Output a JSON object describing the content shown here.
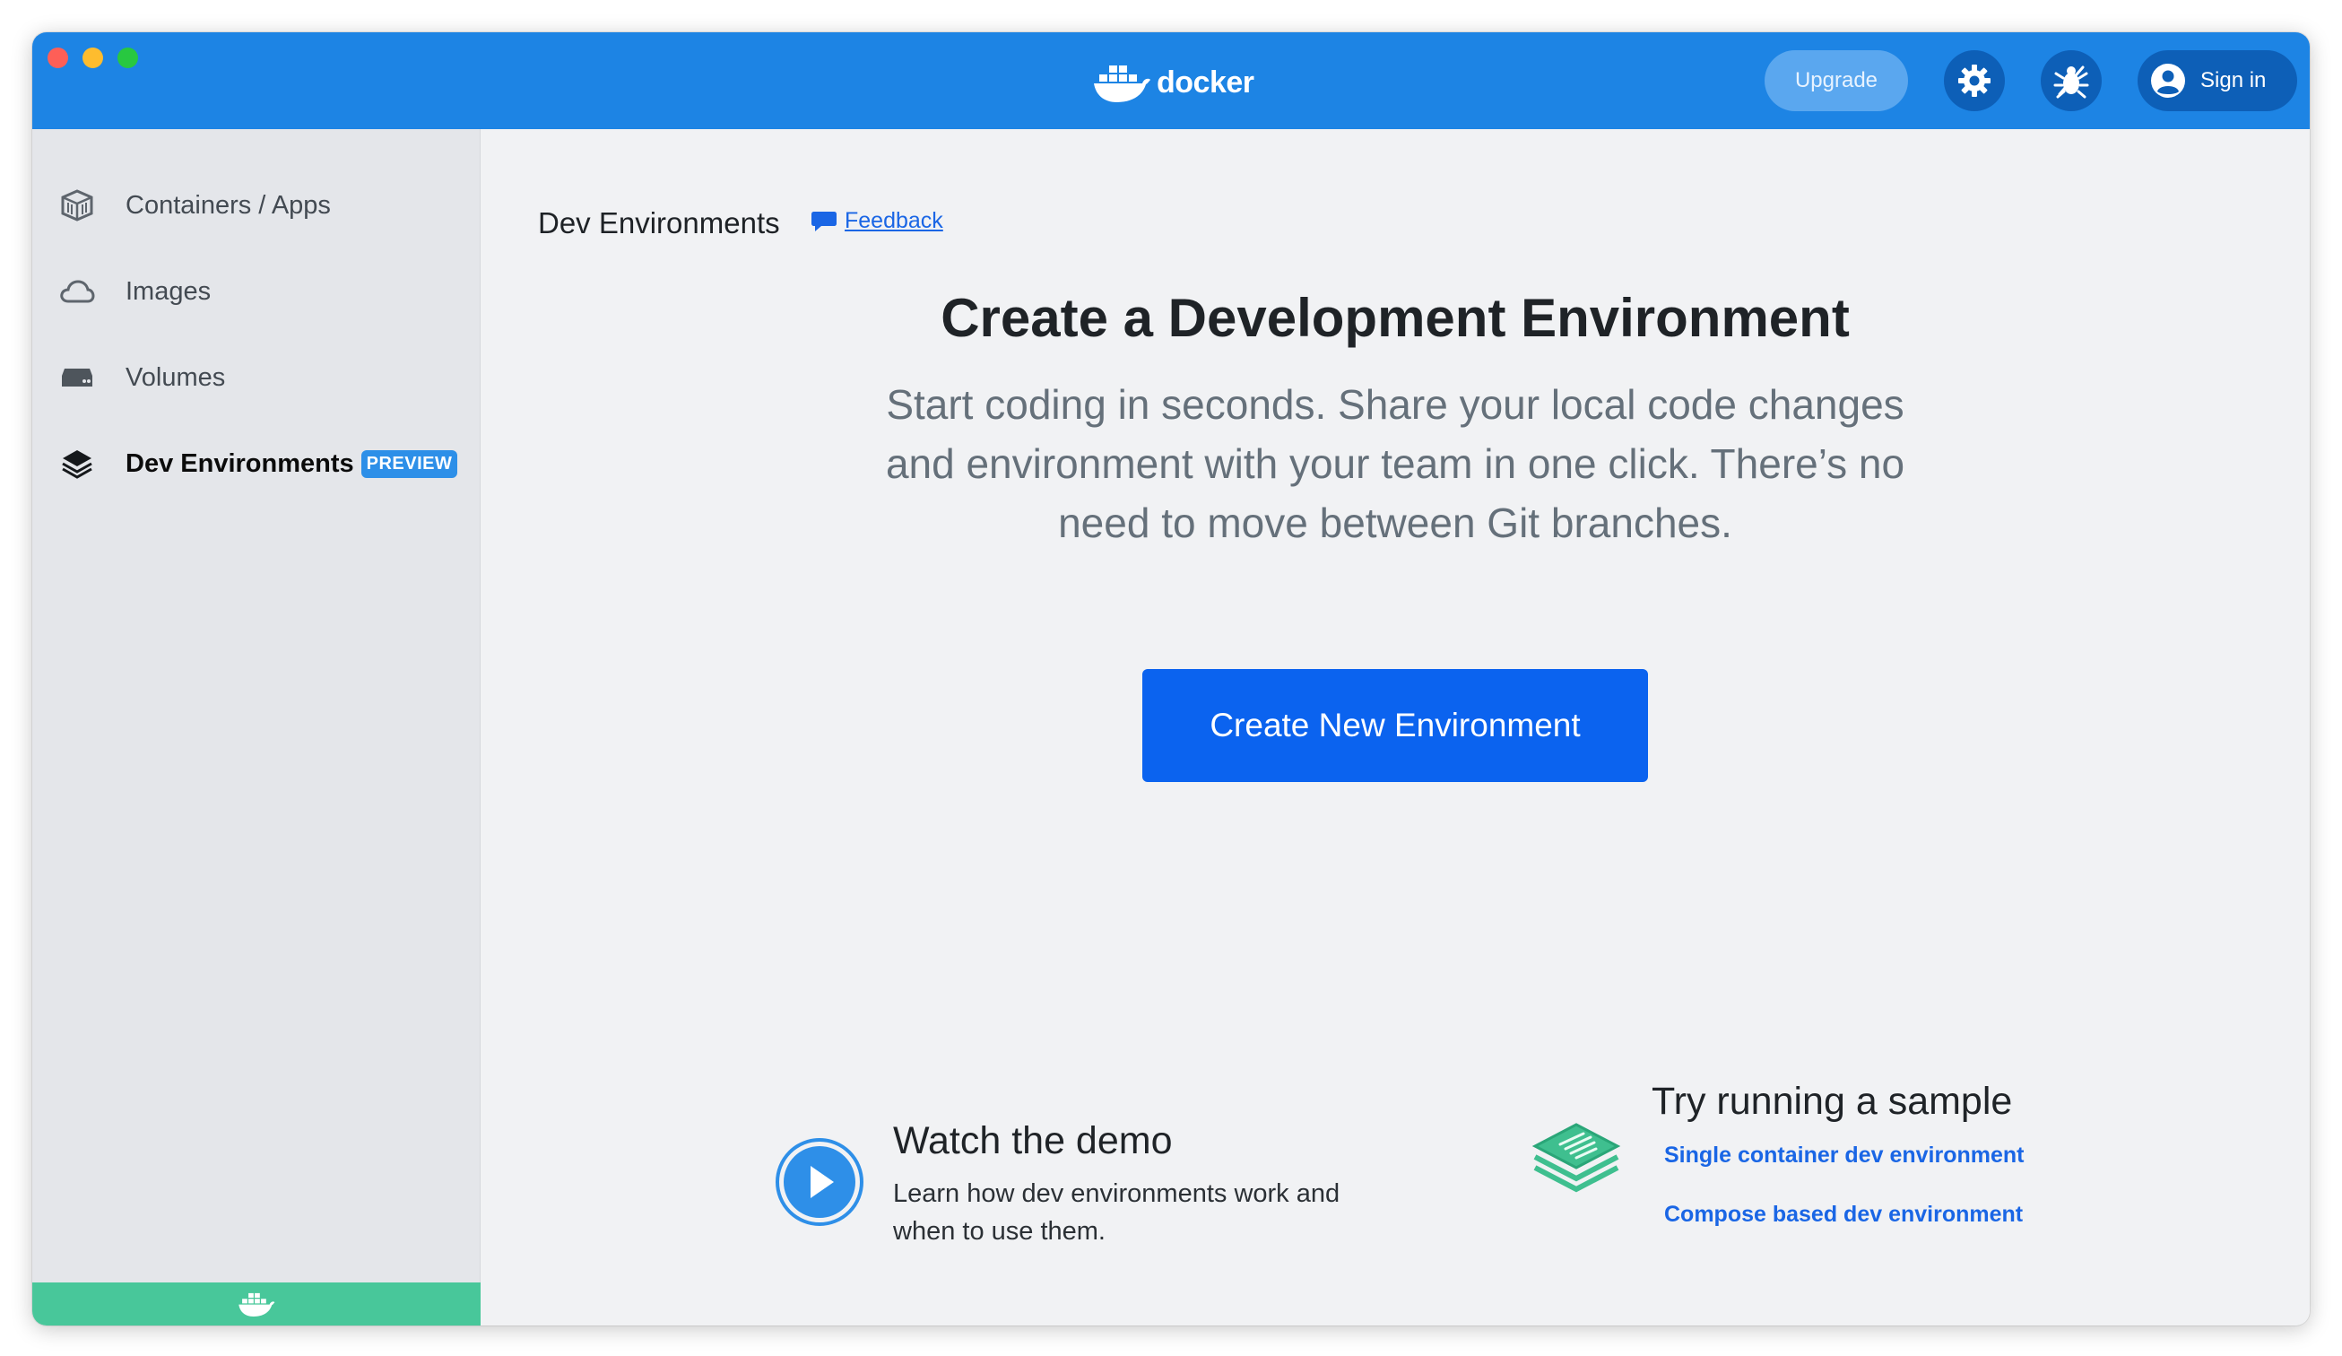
{
  "app": {
    "logo_text": "docker"
  },
  "titlebar": {
    "upgrade_label": "Upgrade",
    "signin_label": "Sign in"
  },
  "sidebar": {
    "items": [
      {
        "label": "Containers / Apps",
        "icon": "containers-icon"
      },
      {
        "label": "Images",
        "icon": "cloud-icon"
      },
      {
        "label": "Volumes",
        "icon": "volume-icon"
      },
      {
        "label": "Dev Environments",
        "icon": "dev-env-icon",
        "badge": "PREVIEW",
        "active": true
      }
    ]
  },
  "main": {
    "page_title": "Dev Environments",
    "feedback_label": "Feedback",
    "heading": "Create a Development Environment",
    "subtitle": "Start coding in seconds. Share your local code changes and environment with your team in one click. There’s no need to move between Git branches.",
    "create_button": "Create New Environment",
    "demo": {
      "title": "Watch the demo",
      "description": "Learn how dev environments work and when to use them."
    },
    "sample": {
      "title": "Try running a sample",
      "links": [
        "Single container dev environment",
        "Compose based dev environment"
      ]
    }
  },
  "colors": {
    "titlebar": "#1d84e4",
    "primary_button": "#0b63ef",
    "link": "#1a66e5",
    "sidebar_footer": "#48c79a",
    "preview_badge": "#2d8fe8"
  }
}
